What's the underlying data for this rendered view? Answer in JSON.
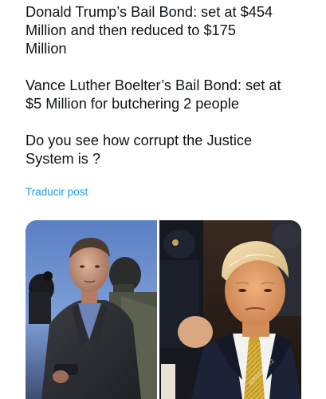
{
  "post": {
    "paragraphs": [
      "Donald Trump’s Bail Bond: set at $454\nMillion and then reduced to $175\nMillion",
      "Vance Luther Boelter’s Bail Bond: set at\n$5 Million for butchering 2 people",
      "Do you see how corrupt the Justice\nSystem is ?"
    ],
    "translate_label": "Traducir post"
  },
  "media": {
    "left_image": "photo-man-in-jacket-with-officers",
    "right_image": "photo-man-in-suit-courtroom",
    "watermark": "@MAGAWHIZ"
  },
  "colors": {
    "text": "#0f1419",
    "link": "#1d9bf0",
    "background": "#ffffff"
  }
}
